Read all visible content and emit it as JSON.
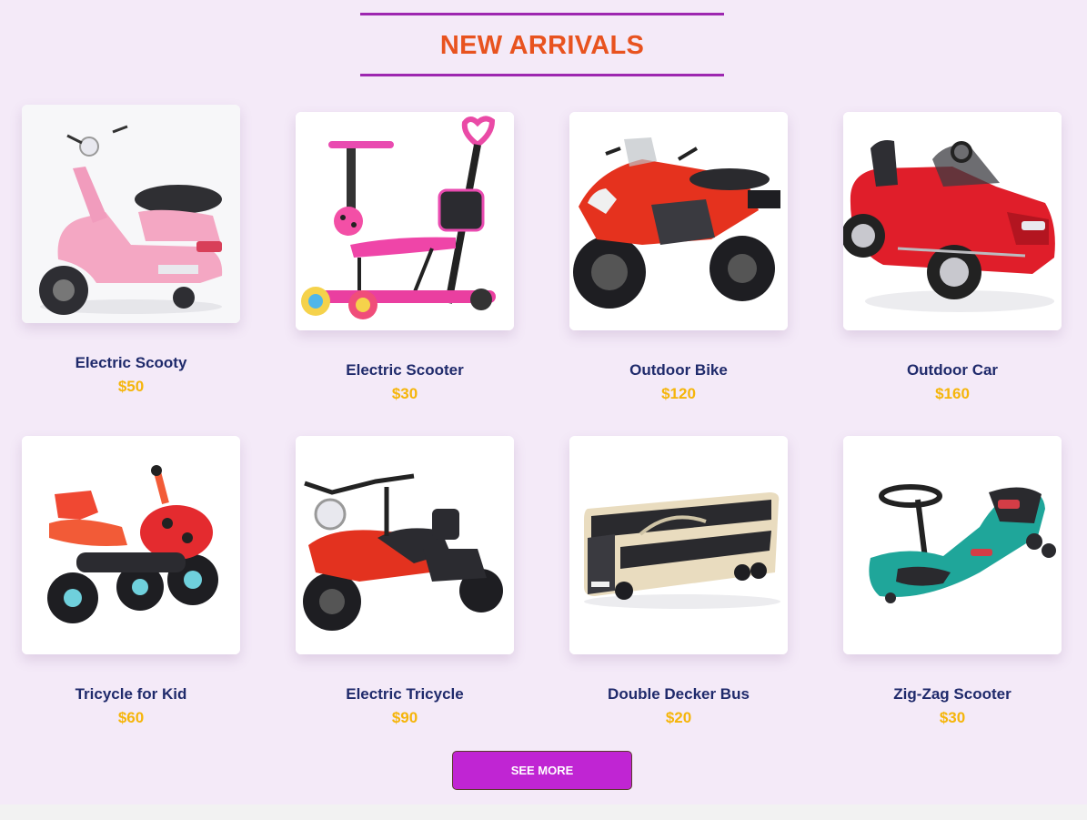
{
  "heading": "NEW ARRIVALS",
  "see_more_label": "SEE MORE",
  "colors": {
    "background": "#f4eaf8",
    "heading": "#e8531f",
    "rule": "#9d27b0",
    "name": "#1f2a6b",
    "price": "#f5b50a",
    "button": "#c025d3"
  },
  "products": [
    {
      "name": "Electric Scooty",
      "price": "$50",
      "image_icon": "pink-scooty-image"
    },
    {
      "name": "Electric Scooter",
      "price": "$30",
      "image_icon": "pink-kick-scooter-image"
    },
    {
      "name": "Outdoor Bike",
      "price": "$120",
      "image_icon": "red-motorbike-image"
    },
    {
      "name": "Outdoor Car",
      "price": "$160",
      "image_icon": "red-ride-on-car-image"
    },
    {
      "name": "Tricycle for Kid",
      "price": "$60",
      "image_icon": "ladybug-tricycle-image"
    },
    {
      "name": "Electric Tricycle",
      "price": "$90",
      "image_icon": "red-trike-motorbike-image"
    },
    {
      "name": "Double Decker Bus",
      "price": "$20",
      "image_icon": "double-decker-bus-image"
    },
    {
      "name": "Zig-Zag Scooter",
      "price": "$30",
      "image_icon": "teal-swing-car-image"
    }
  ]
}
